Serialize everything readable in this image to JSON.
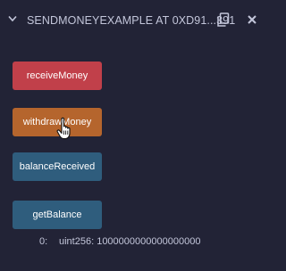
{
  "contract": {
    "title": "SENDMONEYEXAMPLE AT 0XD91...391"
  },
  "icons": {
    "collapse": "chevron-down-icon",
    "copy": "copy-icon",
    "close": "close-icon",
    "cursor": "hand-pointer-icon"
  },
  "functions": [
    {
      "label": "receiveMoney",
      "color": "#c1404a"
    },
    {
      "label": "withdrawMoney",
      "color": "#b5652d"
    },
    {
      "label": "balanceReceived",
      "color": "#2f5d7d"
    },
    {
      "label": "getBalance",
      "color": "#2f5d7d"
    }
  ],
  "result": {
    "index": "0:",
    "value": "uint256: 1000000000000000000"
  }
}
